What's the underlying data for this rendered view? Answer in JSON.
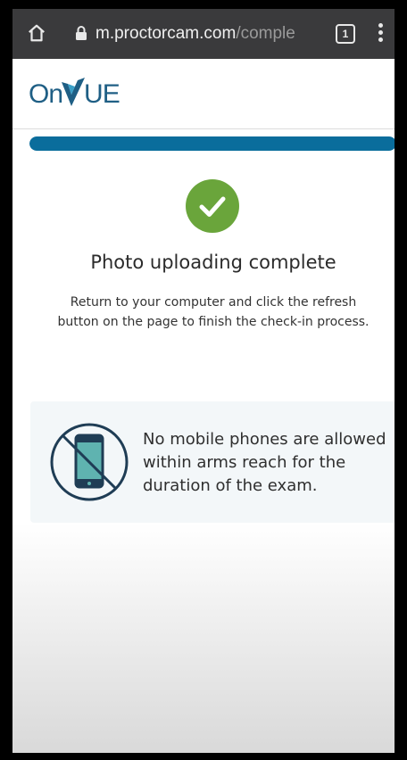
{
  "browser": {
    "url_host": "m.proctorcam.com",
    "url_path": "/comple",
    "tab_count": "1"
  },
  "header": {
    "logo_on": "On",
    "logo_ue": "UE"
  },
  "progress": {
    "value": 1.0
  },
  "status": {
    "title": "Photo uploading complete",
    "description": "Return to your computer and click the refresh button on the page to finish the check-in process."
  },
  "notice": {
    "text": "No mobile phones are allowed within arms reach for the duration of the exam."
  },
  "colors": {
    "brand": "#1f5f85",
    "progress": "#0a6d9c",
    "success": "#6aa53b"
  }
}
